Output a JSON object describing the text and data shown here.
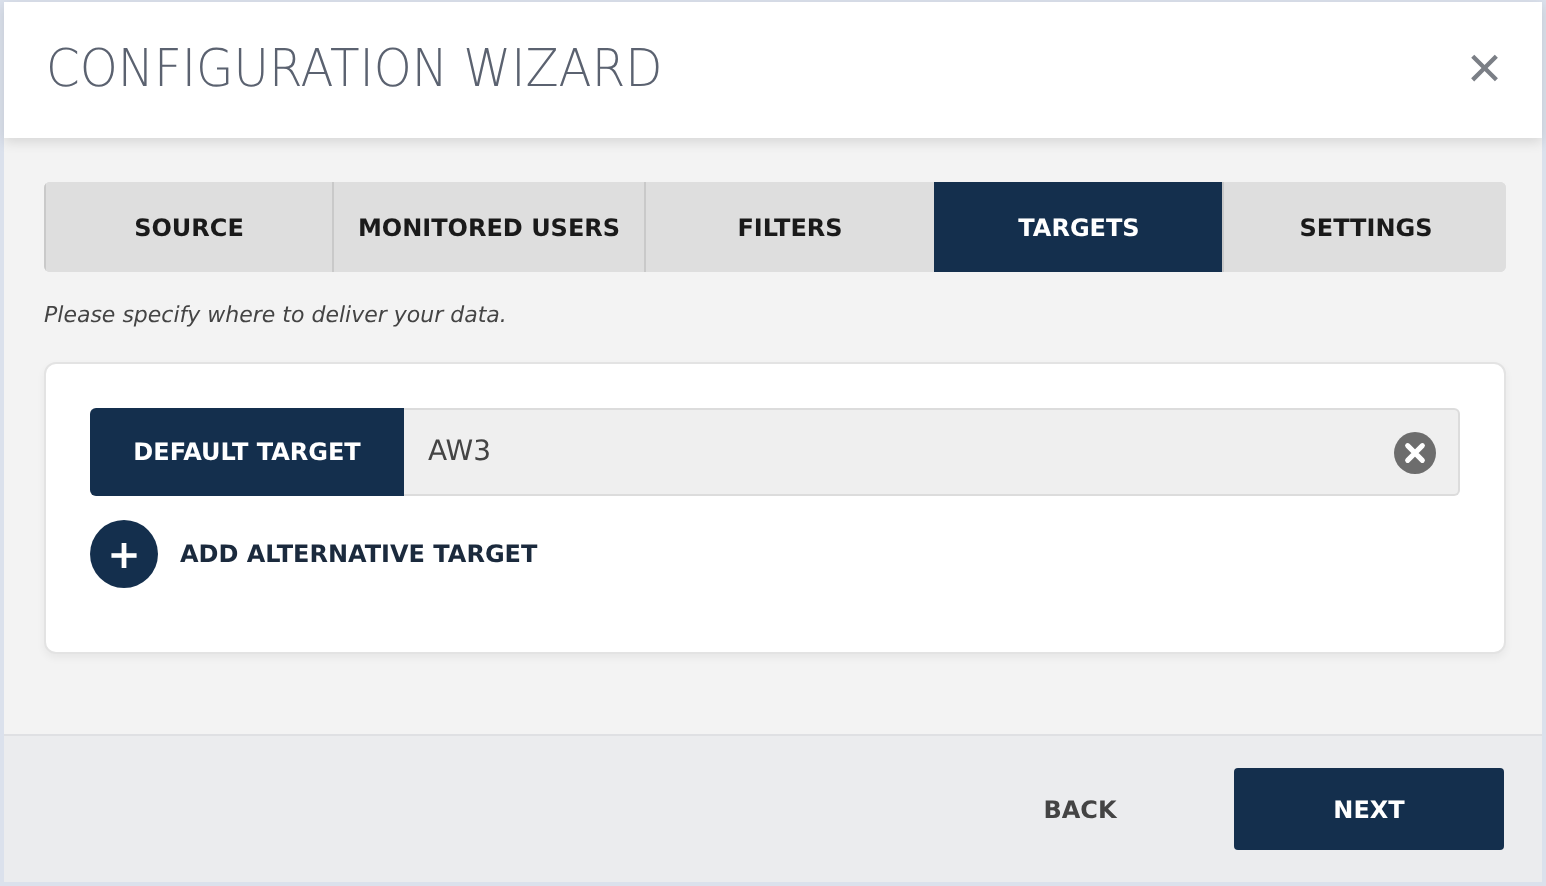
{
  "window": {
    "title": "CONFIGURATION WIZARD",
    "close": "×"
  },
  "tabs": [
    {
      "label": "SOURCE",
      "selected": false
    },
    {
      "label": "MONITORED USERS",
      "selected": false
    },
    {
      "label": "FILTERS",
      "selected": false
    },
    {
      "label": "TARGETS",
      "selected": true
    },
    {
      "label": "SETTINGS",
      "selected": false
    }
  ],
  "instruction": "Please specify where to deliver your data.",
  "default_target": {
    "label": "DEFAULT TARGET",
    "value": "AW3"
  },
  "add_alternative": {
    "icon": "+",
    "label": "ADD ALTERNATIVE TARGET"
  },
  "buttons": [
    {
      "label": "BACK",
      "kind": "secondary"
    },
    {
      "label": "NEXT",
      "kind": "primary"
    }
  ]
}
